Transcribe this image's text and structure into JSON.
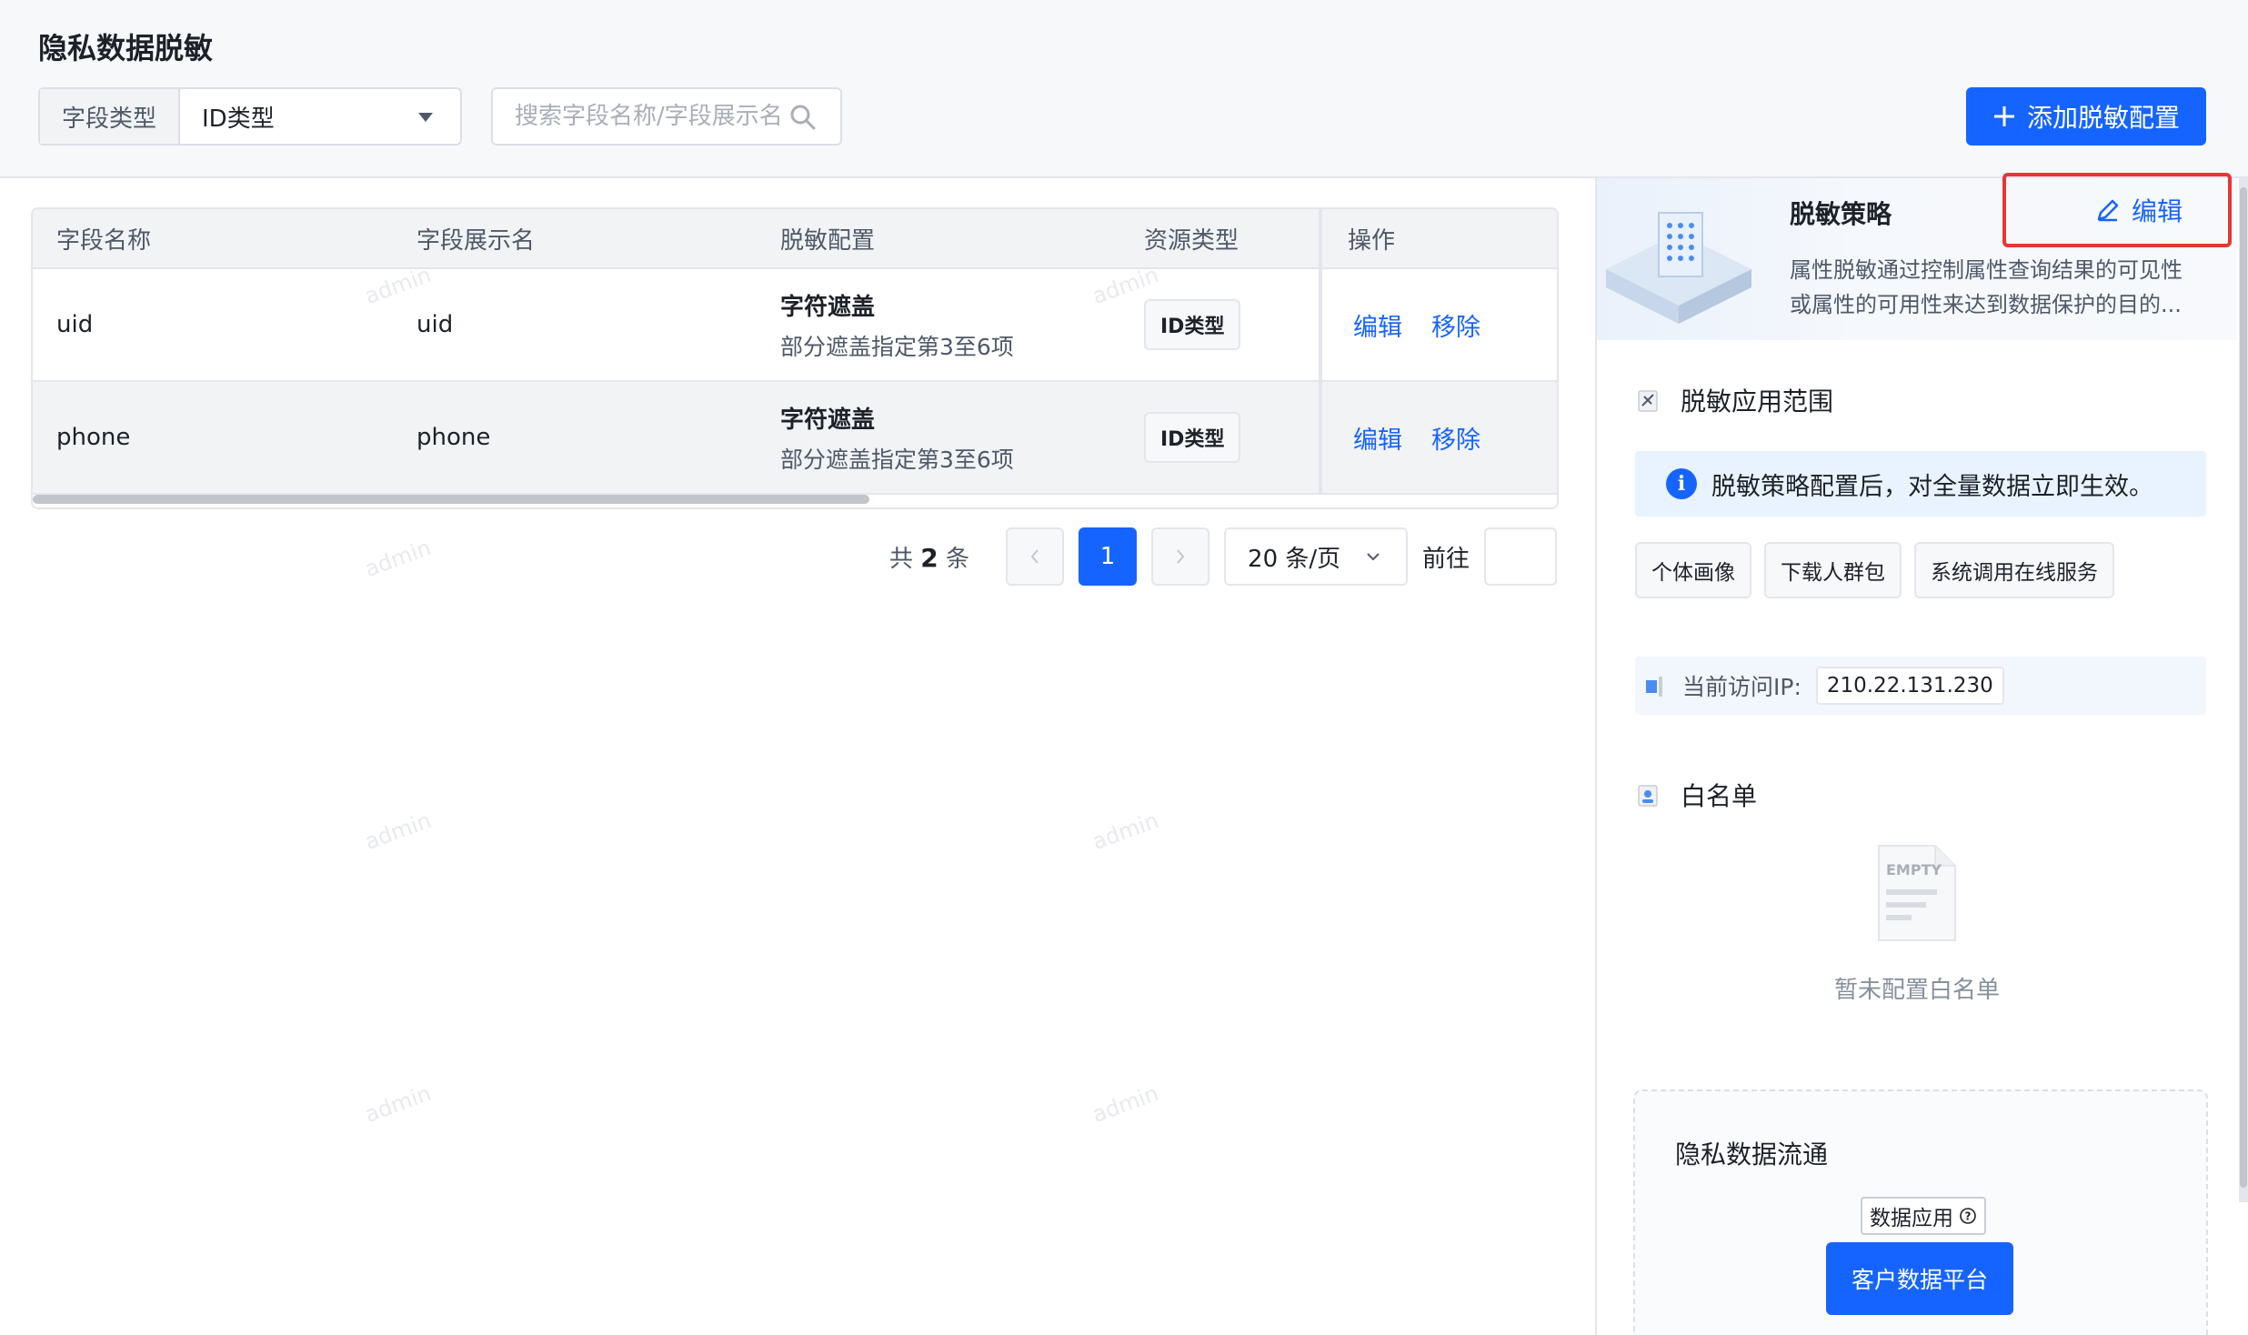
{
  "page": {
    "title": "隐私数据脱敏",
    "watermark": "admin"
  },
  "filter": {
    "label": "字段类型",
    "value": "ID类型"
  },
  "search": {
    "placeholder": "搜索字段名称/字段展示名"
  },
  "toolbar": {
    "add_label": "添加脱敏配置"
  },
  "table": {
    "headers": [
      "字段名称",
      "字段展示名",
      "脱敏配置",
      "资源类型",
      "操作"
    ],
    "rows": [
      {
        "name": "uid",
        "display": "uid",
        "mask_title": "字符遮盖",
        "mask_desc": "部分遮盖指定第3至6项",
        "resource": "ID类型",
        "edit": "编辑",
        "remove": "移除"
      },
      {
        "name": "phone",
        "display": "phone",
        "mask_title": "字符遮盖",
        "mask_desc": "部分遮盖指定第3至6项",
        "resource": "ID类型",
        "edit": "编辑",
        "remove": "移除"
      }
    ]
  },
  "pagination": {
    "prefix": "共",
    "total": "2",
    "suffix": "条",
    "current": "1",
    "page_size": "20 条/页",
    "jump_label": "前往"
  },
  "strategy": {
    "title": "脱敏策略",
    "edit_label": "编辑",
    "description": "属性脱敏通过控制属性查询结果的可见性或属性的可用性来达到数据保护的目的..."
  },
  "scope": {
    "title": "脱敏应用范围",
    "alert": "脱敏策略配置后，对全量数据立即生效。",
    "tags": [
      "个体画像",
      "下载人群包",
      "系统调用在线服务"
    ]
  },
  "ip": {
    "label": "当前访问IP:",
    "value": "210.22.131.230"
  },
  "whitelist": {
    "title": "白名单",
    "empty_badge": "EMPTY",
    "empty_text": "暂未配置白名单"
  },
  "flow": {
    "title": "隐私数据流通",
    "chip": "数据应用",
    "platform": "客户数据平台"
  },
  "colors": {
    "primary": "#1664ff",
    "highlight_border": "#e83535"
  }
}
